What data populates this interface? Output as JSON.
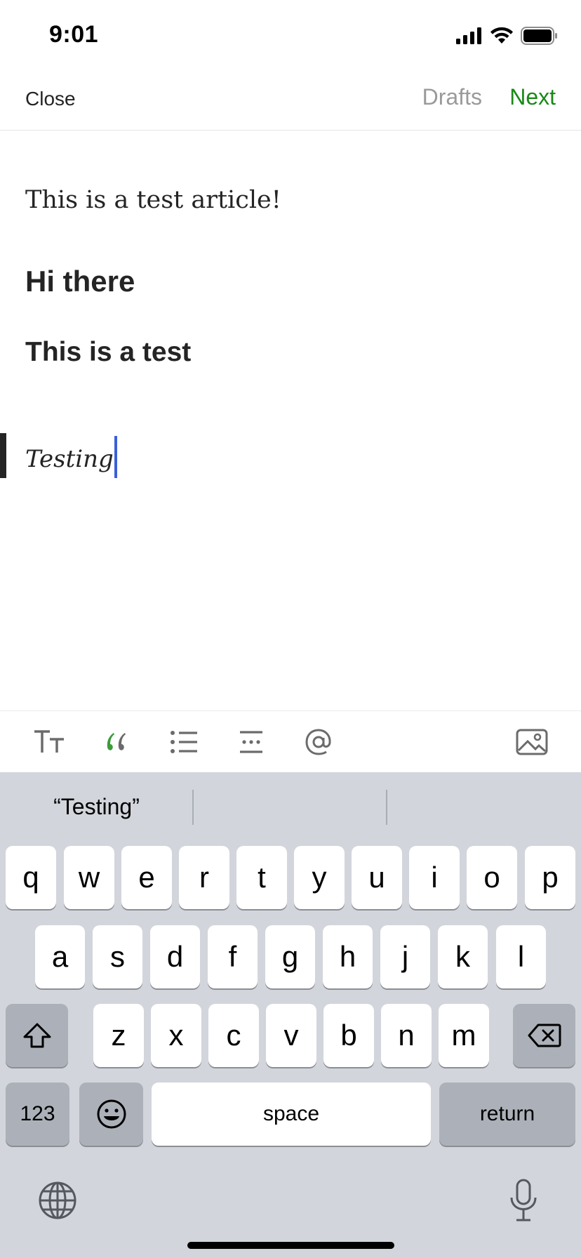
{
  "status_bar": {
    "time": "9:01",
    "icons": [
      "cellular-signal-icon",
      "wifi-icon",
      "battery-icon"
    ]
  },
  "nav": {
    "close_label": "Close",
    "drafts_label": "Drafts",
    "next_label": "Next"
  },
  "editor": {
    "paragraph": "This is a test article!",
    "heading_1": "Hi there",
    "heading_2": "This is a test",
    "quote": "Testing"
  },
  "format_toolbar": {
    "tools": [
      "text-size-icon",
      "quote-icon",
      "bulleted-list-icon",
      "separator-icon",
      "mention-icon",
      "image-icon"
    ]
  },
  "keyboard": {
    "suggestions": [
      "“Testing”",
      "",
      ""
    ],
    "row1": [
      "q",
      "w",
      "e",
      "r",
      "t",
      "y",
      "u",
      "i",
      "o",
      "p"
    ],
    "row2": [
      "a",
      "s",
      "d",
      "f",
      "g",
      "h",
      "j",
      "k",
      "l"
    ],
    "row3": [
      "z",
      "x",
      "c",
      "v",
      "b",
      "n",
      "m"
    ],
    "numbers_label": "123",
    "space_label": "space",
    "return_label": "return",
    "icons": [
      "shift-icon",
      "backspace-icon",
      "emoji-icon",
      "globe-icon",
      "microphone-icon"
    ]
  },
  "colors": {
    "accent_green": "#1a8917",
    "muted_gray": "#9a9a9a",
    "caret_blue": "#3a5fd9",
    "keyboard_bg": "#d2d5db"
  }
}
